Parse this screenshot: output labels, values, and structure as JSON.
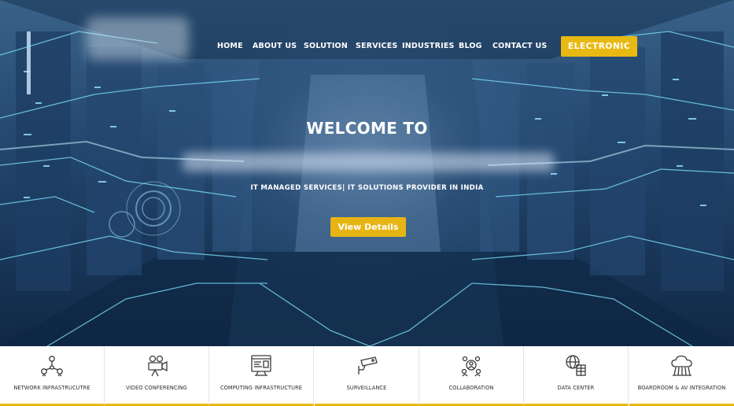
{
  "nav": {
    "items": [
      {
        "label": "HOME"
      },
      {
        "label": "ABOUT US"
      },
      {
        "label": "SOLUTION"
      },
      {
        "label": "SERVICES"
      },
      {
        "label": "INDUSTRIES"
      },
      {
        "label": "BLOG"
      },
      {
        "label": "CONTACT US"
      }
    ],
    "cta_label": "ELECTRONIC"
  },
  "hero": {
    "welcome": "WELCOME TO",
    "tagline": "IT MANAGED SERVICES| IT SOLUTIONS PROVIDER IN INDIA",
    "button_label": "View Details"
  },
  "categories": [
    {
      "label": "NETWORK INFRASTRUCUTRE",
      "icon": "network-icon"
    },
    {
      "label": "VIDEO CONFERENCING",
      "icon": "video-camera-icon"
    },
    {
      "label": "COMPUTING INFRASTRUCTURE",
      "icon": "computer-icon"
    },
    {
      "label": "SURVEILLANCE",
      "icon": "cctv-camera-icon"
    },
    {
      "label": "COLLABORATION",
      "icon": "collaboration-icon"
    },
    {
      "label": "DATA CENTER",
      "icon": "data-center-icon"
    },
    {
      "label": "BOARDROOM & AV INTEGRATION",
      "icon": "cloud-icon"
    }
  ],
  "colors": {
    "accent": "#e9b913",
    "hero_dark": "#183557",
    "icon_stroke": "#3a3a3a"
  }
}
